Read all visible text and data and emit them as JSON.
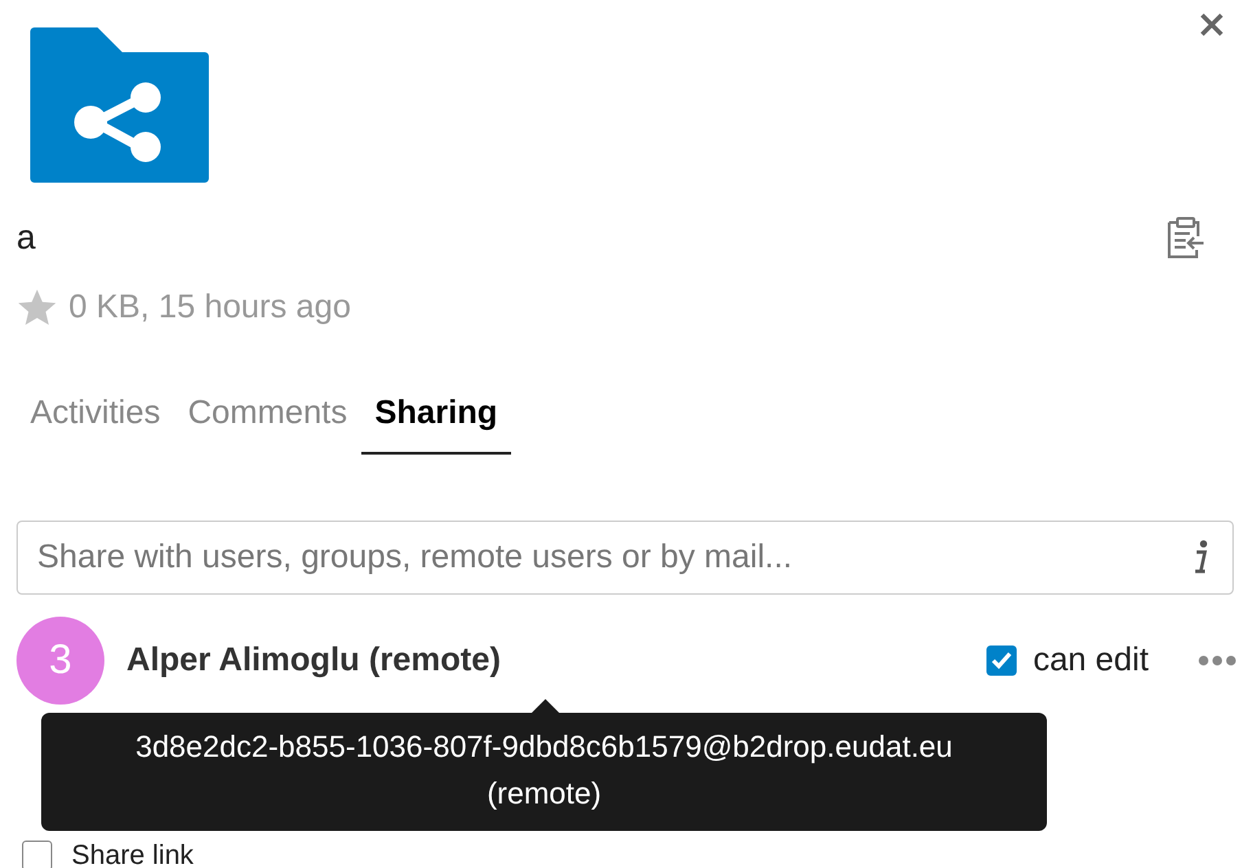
{
  "file": {
    "name": "a",
    "favorite": false,
    "meta": "0 KB, 15 hours ago"
  },
  "tabs": [
    {
      "label": "Activities",
      "selected": false
    },
    {
      "label": "Comments",
      "selected": false
    },
    {
      "label": "Sharing",
      "selected": true
    }
  ],
  "search": {
    "placeholder": "Share with users, groups, remote users or by mail..."
  },
  "shares": [
    {
      "avatar": "3",
      "color": "#e27de2",
      "name": "Alper Alimoglu (remote)",
      "can_edit": true,
      "permission_label": "can edit",
      "tooltip": [
        "3d8e2dc2-b855-1036-807f-9dbd8c6b1579@b2drop.eudat.eu",
        "(remote)"
      ]
    }
  ],
  "share_link": {
    "label": "Share link",
    "checked": false
  }
}
